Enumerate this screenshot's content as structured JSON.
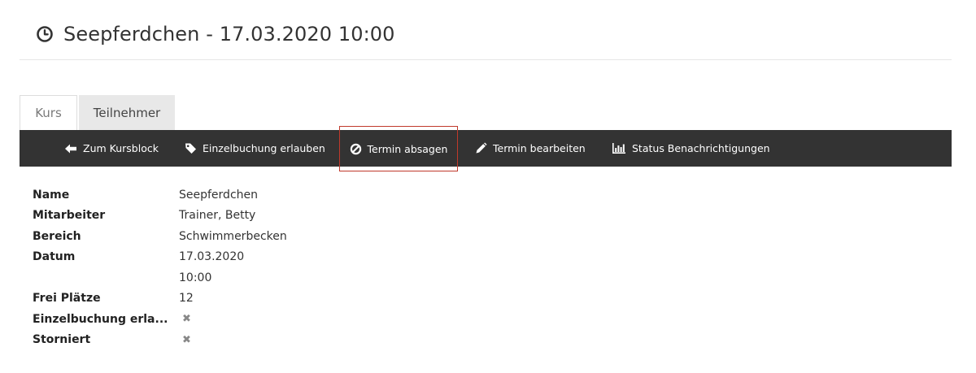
{
  "header": {
    "title": "Seepferdchen - 17.03.2020 10:00",
    "icon": "clock-icon"
  },
  "tabs": [
    {
      "label": "Kurs",
      "active": true
    },
    {
      "label": "Teilnehmer",
      "active": false
    }
  ],
  "toolbar": {
    "back": {
      "label": "Zum Kursblock",
      "icon": "arrow-left-icon"
    },
    "single_booking": {
      "label": "Einzelbuchung erlauben",
      "icon": "tag-icon"
    },
    "cancel": {
      "label": "Termin absagen",
      "icon": "ban-icon",
      "highlighted": true
    },
    "edit": {
      "label": "Termin bearbeiten",
      "icon": "pencil-icon"
    },
    "status": {
      "label": "Status Benachrichtigungen",
      "icon": "bar-chart-icon"
    }
  },
  "details": {
    "name": {
      "label": "Name",
      "value": "Seepferdchen"
    },
    "staff": {
      "label": "Mitarbeiter",
      "value": "Trainer, Betty"
    },
    "area": {
      "label": "Bereich",
      "value": "Schwimmerbecken"
    },
    "date": {
      "label": "Datum",
      "value": "17.03.2020",
      "time": "10:00"
    },
    "free_spots": {
      "label": "Frei Plätze",
      "value": "12"
    },
    "single_booking": {
      "label": "Einzelbuchung erla...",
      "value": "✖"
    },
    "cancelled": {
      "label": "Storniert",
      "value": "✖"
    }
  },
  "colors": {
    "toolbar_bg": "#333333",
    "highlight_border": "#c0392b",
    "inactive_tab_bg": "#e8e8e8"
  }
}
